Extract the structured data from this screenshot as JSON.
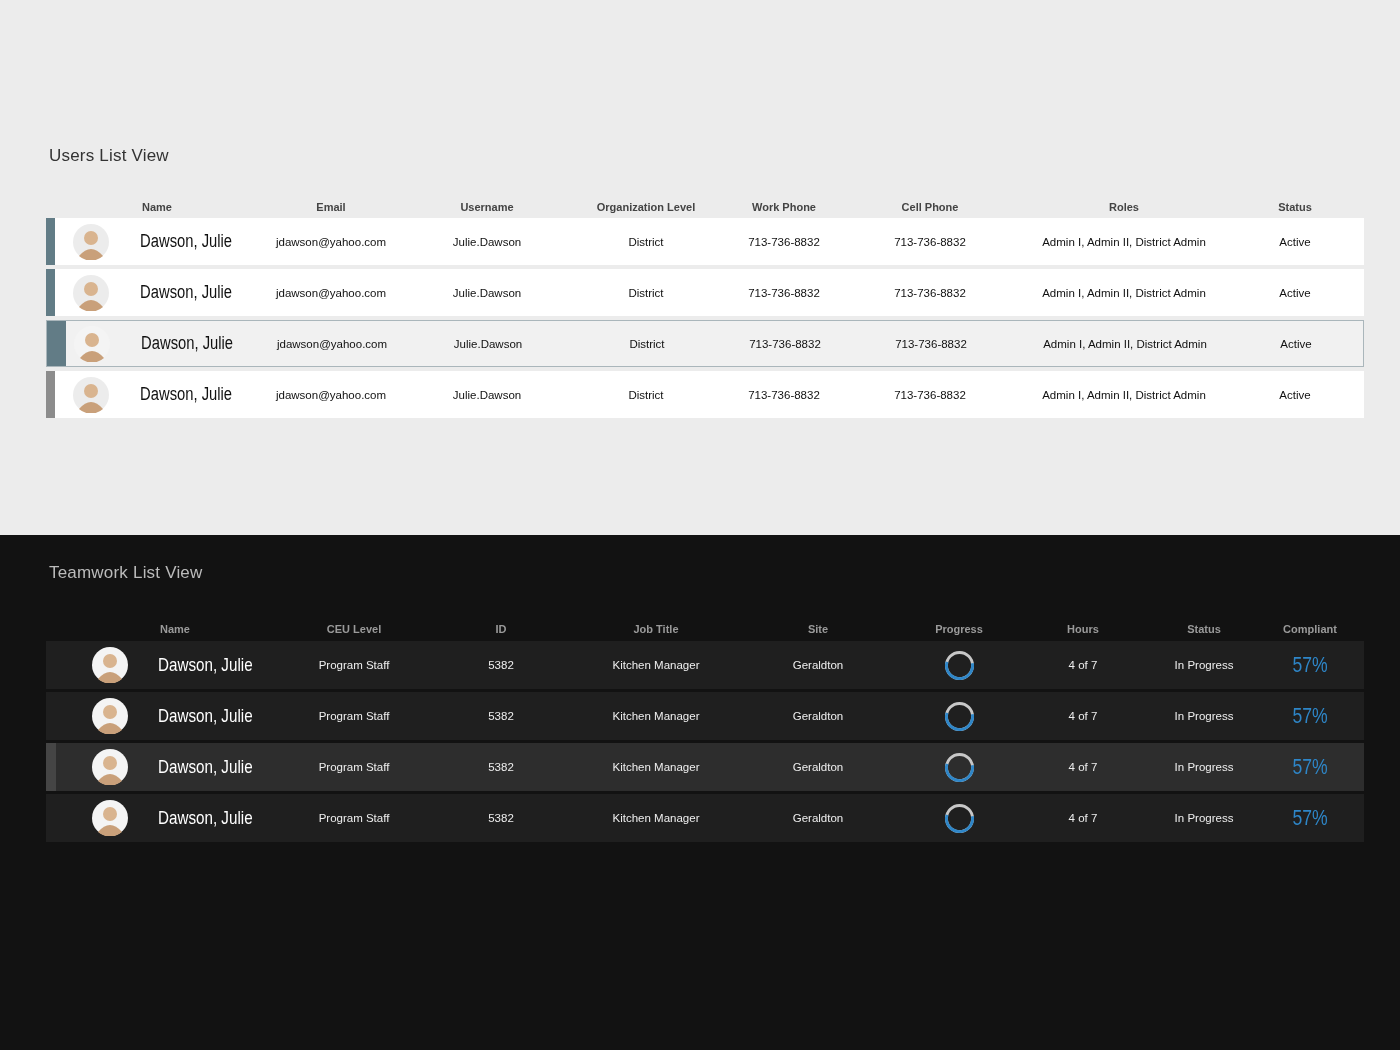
{
  "users_list": {
    "title": "Users List View",
    "columns": [
      "Name",
      "Email",
      "Username",
      "Organization Level",
      "Work Phone",
      "Cell Phone",
      "Roles",
      "Status"
    ],
    "rows": [
      {
        "name": "Dawson, Julie",
        "email": "jdawson@yahoo.com",
        "username": "Julie.Dawson",
        "organization_level": "District",
        "work_phone": "713-736-8832",
        "cell_phone": "713-736-8832",
        "roles": "Admin I, Admin II, District Admin",
        "status": "Active",
        "color": "#627c86",
        "selected": false
      },
      {
        "name": "Dawson, Julie",
        "email": "jdawson@yahoo.com",
        "username": "Julie.Dawson",
        "organization_level": "District",
        "work_phone": "713-736-8832",
        "cell_phone": "713-736-8832",
        "roles": "Admin I, Admin II, District Admin",
        "status": "Active",
        "color": "#627c86",
        "selected": false
      },
      {
        "name": "Dawson, Julie",
        "email": "jdawson@yahoo.com",
        "username": "Julie.Dawson",
        "organization_level": "District",
        "work_phone": "713-736-8832",
        "cell_phone": "713-736-8832",
        "roles": "Admin I, Admin II, District Admin",
        "status": "Active",
        "color": "#627c86",
        "selected": true
      },
      {
        "name": "Dawson, Julie",
        "email": "jdawson@yahoo.com",
        "username": "Julie.Dawson",
        "organization_level": "District",
        "work_phone": "713-736-8832",
        "cell_phone": "713-736-8832",
        "roles": "Admin I, Admin II, District Admin",
        "status": "Active",
        "color": "#8c8c8c",
        "selected": false
      }
    ]
  },
  "teamwork_list": {
    "title": "Teamwork List View",
    "columns": [
      "Name",
      "CEU Level",
      "ID",
      "Job Title",
      "Site",
      "Progress",
      "Hours",
      "Status",
      "Compliant"
    ],
    "rows": [
      {
        "name": "Dawson, Julie",
        "ceu_level": "Program Staff",
        "id": "5382",
        "job_title": "Kitchen Manager",
        "site": "Geraldton",
        "progress": {
          "level": 0.57
        },
        "hours": "4 of 7",
        "status": "In Progress",
        "compliant": "57%",
        "selected": false
      },
      {
        "name": "Dawson, Julie",
        "ceu_level": "Program Staff",
        "id": "5382",
        "job_title": "Kitchen Manager",
        "site": "Geraldton",
        "progress": {
          "level": 0.57
        },
        "hours": "4 of 7",
        "status": "In Progress",
        "compliant": "57%",
        "selected": false
      },
      {
        "name": "Dawson, Julie",
        "ceu_level": "Program Staff",
        "id": "5382",
        "job_title": "Kitchen Manager",
        "site": "Geraldton",
        "progress": {
          "level": 0.57
        },
        "hours": "4 of 7",
        "status": "In Progress",
        "compliant": "57%",
        "selected": true
      },
      {
        "name": "Dawson, Julie",
        "ceu_level": "Program Staff",
        "id": "5382",
        "job_title": "Kitchen Manager",
        "site": "Geraldton",
        "progress": {
          "level": 0.57
        },
        "hours": "4 of 7",
        "status": "In Progress",
        "compliant": "57%",
        "selected": false
      }
    ]
  }
}
